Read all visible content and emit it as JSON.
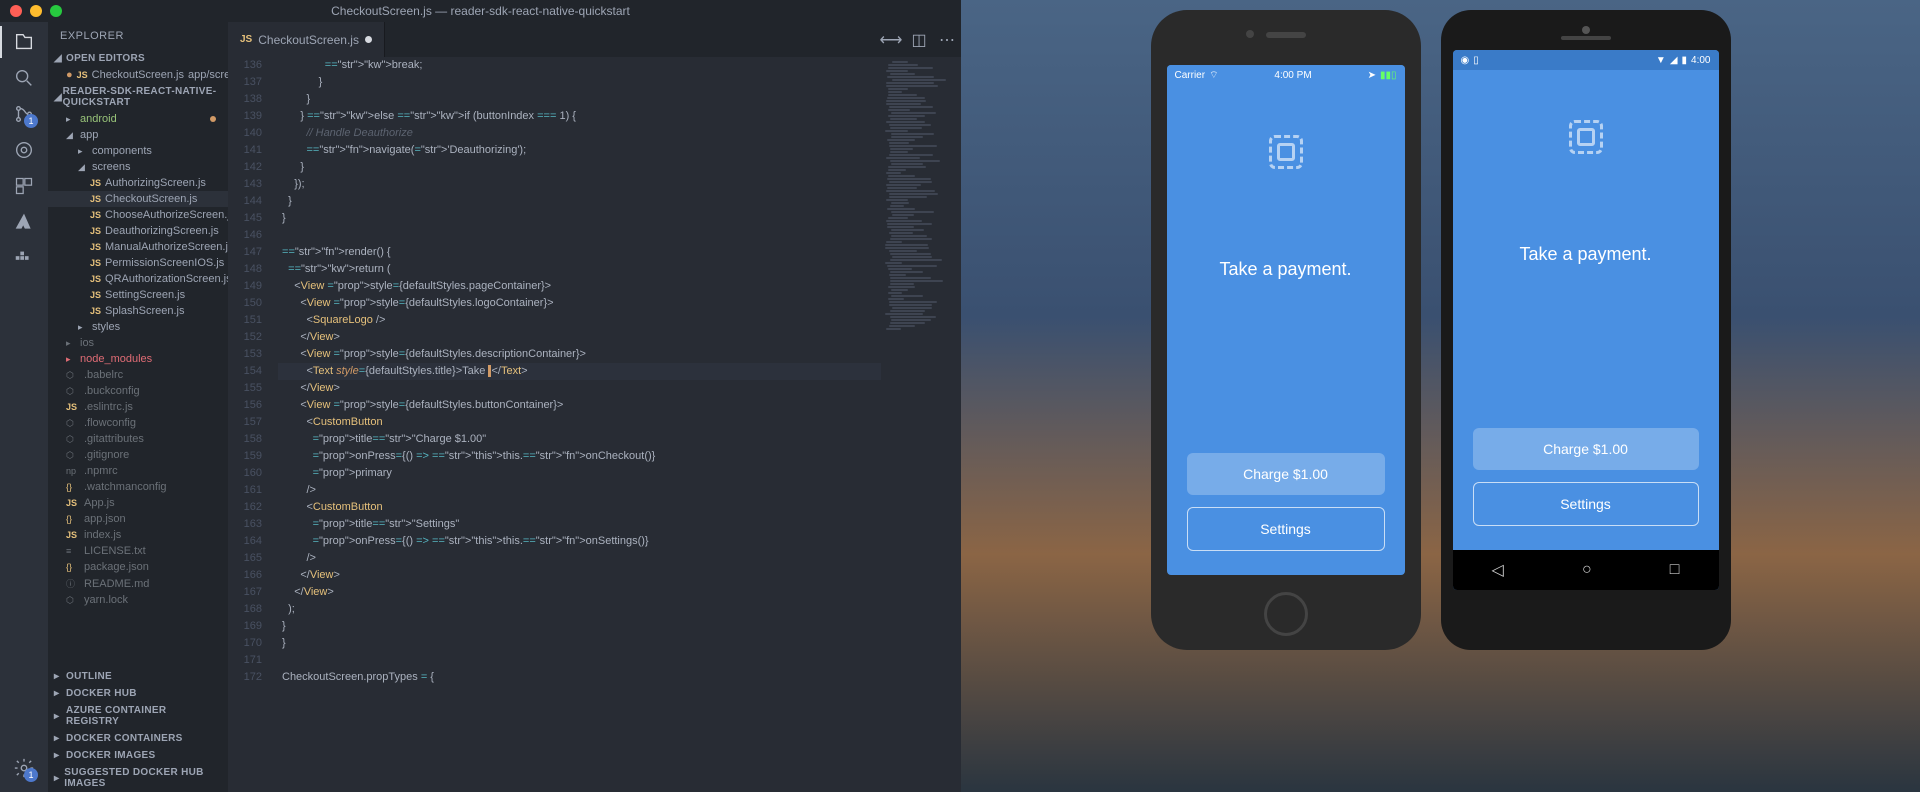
{
  "window": {
    "title": "CheckoutScreen.js — reader-sdk-react-native-quickstart"
  },
  "activitybar": {
    "scm_badge": "1",
    "gear_badge": "1"
  },
  "sidebar": {
    "title": "EXPLORER",
    "sections": {
      "open_editors": "OPEN EDITORS",
      "project": "READER-SDK-REACT-NATIVE-QUICKSTART",
      "outline": "OUTLINE",
      "docker_hub": "DOCKER HUB",
      "azure": "AZURE CONTAINER REGISTRY",
      "docker_containers": "DOCKER CONTAINERS",
      "docker_images": "DOCKER IMAGES",
      "suggested": "SUGGESTED DOCKER HUB IMAGES"
    },
    "open_editor_item": {
      "name": "CheckoutScreen.js",
      "path": "app/screens"
    },
    "tree": {
      "android": "android",
      "app": "app",
      "components": "components",
      "screens": "screens",
      "files": [
        "AuthorizingScreen.js",
        "CheckoutScreen.js",
        "ChooseAuthorizeScreen.js",
        "DeauthorizingScreen.js",
        "ManualAuthorizeScreen.js",
        "PermissionScreenIOS.js",
        "QRAuthorizationScreen.js",
        "SettingScreen.js",
        "SplashScreen.js"
      ],
      "styles": "styles",
      "ios": "ios",
      "node_modules": "node_modules",
      "root_files": [
        ".babelrc",
        ".buckconfig",
        ".eslintrc.js",
        ".flowconfig",
        ".gitattributes",
        ".gitignore",
        ".npmrc",
        ".watchmanconfig",
        "App.js",
        "app.json",
        "index.js",
        "LICENSE.txt",
        "package.json",
        "README.md",
        "yarn.lock"
      ]
    }
  },
  "tab": {
    "name": "CheckoutScreen.js"
  },
  "code_lines": {
    "start": 136,
    "lines": [
      "              break;",
      "            }",
      "        }",
      "      } else if (buttonIndex === 1) {",
      "        // Handle Deauthorize",
      "        navigate('Deauthorizing');",
      "      }",
      "    });",
      "  }",
      "}",
      "",
      "render() {",
      "  return (",
      "    <View style={defaultStyles.pageContainer}>",
      "      <View style={defaultStyles.logoContainer}>",
      "        <SquareLogo />",
      "      </View>",
      "      <View style={defaultStyles.descriptionContainer}>",
      "        <Text style={defaultStyles.title}>Take </Text>",
      "      </View>",
      "      <View style={defaultStyles.buttonContainer}>",
      "        <CustomButton",
      "          title=\"Charge $1.00\"",
      "          onPress={() => this.onCheckout()}",
      "          primary",
      "        />",
      "        <CustomButton",
      "          title=\"Settings\"",
      "          onPress={() => this.onSettings()}",
      "        />",
      "      </View>",
      "    </View>",
      "  );",
      "}",
      "}",
      "",
      "CheckoutScreen.propTypes = {"
    ]
  },
  "simulator": {
    "ios": {
      "carrier": "Carrier",
      "time": "4:00 PM"
    },
    "android": {
      "time": "4:00"
    },
    "app": {
      "title": "Take a payment.",
      "charge_btn": "Charge $1.00",
      "settings_btn": "Settings"
    }
  }
}
